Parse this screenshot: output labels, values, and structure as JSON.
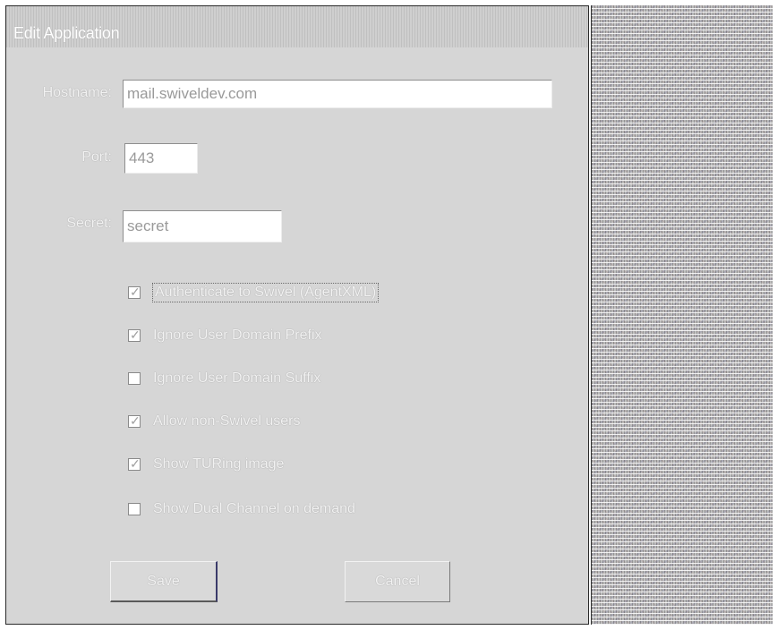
{
  "window": {
    "title": "Edit Application"
  },
  "form": {
    "hostname_label": "Hostname:",
    "hostname_value": "mail.swiveldev.com",
    "port_label": "Port:",
    "port_value": "443",
    "secret_label": "Secret:",
    "secret_value": "secret"
  },
  "options": [
    {
      "label": "Authenticate to Swivel (AgentXML)",
      "checked": true,
      "focused": true
    },
    {
      "label": "Ignore User Domain Prefix",
      "checked": true,
      "focused": false
    },
    {
      "label": "Ignore User Domain Suffix",
      "checked": false,
      "focused": false
    },
    {
      "label": "Allow non-Swivel users",
      "checked": true,
      "focused": false
    },
    {
      "label": "Show TURing image",
      "checked": true,
      "focused": false
    },
    {
      "label": "Show Dual Channel on demand",
      "checked": false,
      "focused": false
    }
  ],
  "buttons": {
    "save_label": "Save",
    "cancel_label": "Cancel"
  }
}
